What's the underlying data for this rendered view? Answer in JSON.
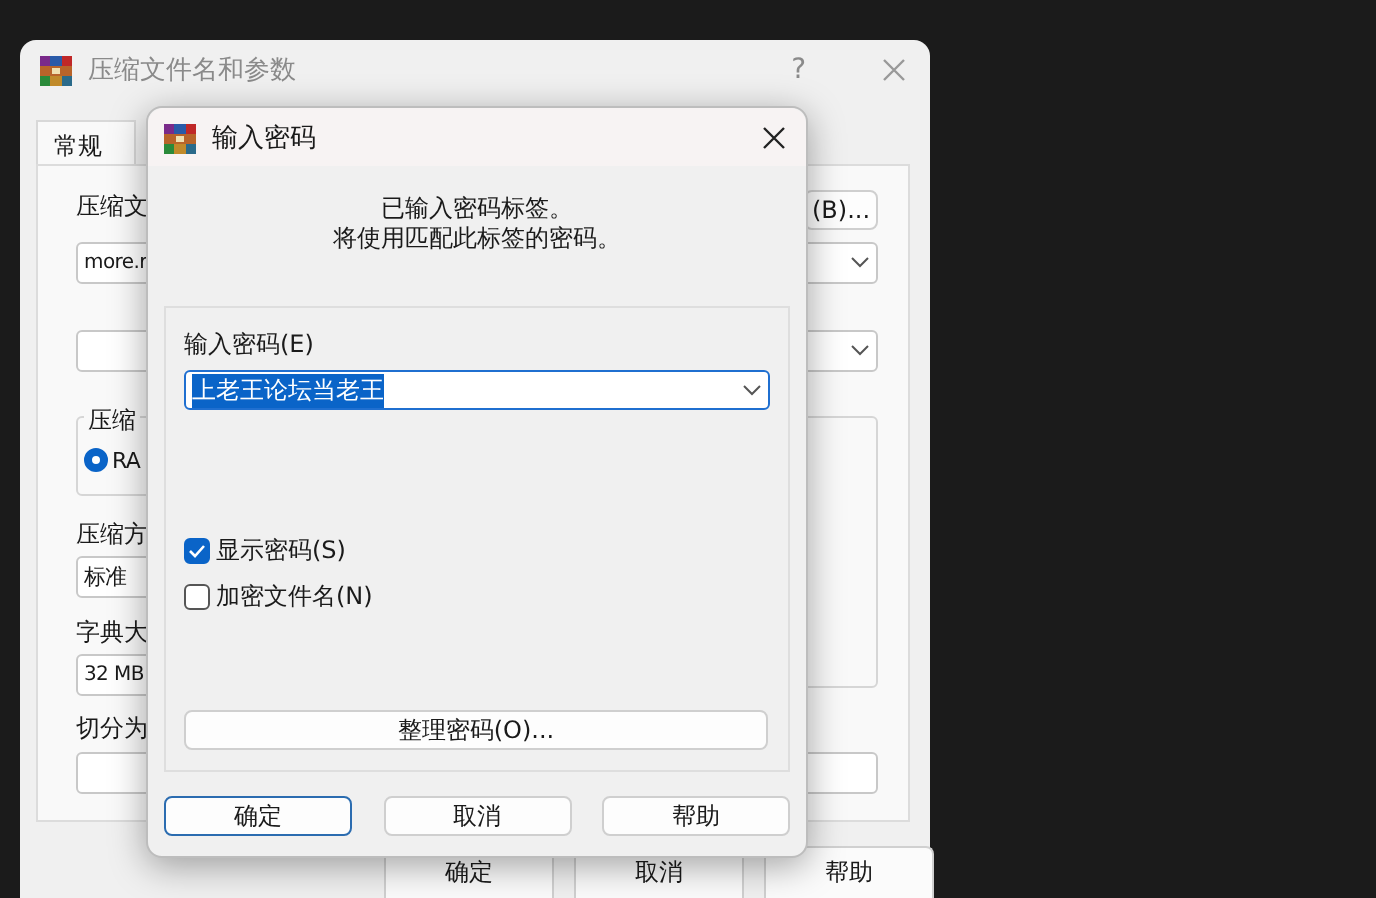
{
  "main_window": {
    "title": "压缩文件名和参数",
    "help": "?",
    "tabs": [
      {
        "label": "常规",
        "selected": true
      }
    ],
    "archive_label": "压缩文",
    "browse_button": "(B)...",
    "archive_name": "more.r",
    "format_group": "压缩",
    "format_option": {
      "label": "RA",
      "selected": true
    },
    "method_label": "压缩方",
    "method_value": "标准",
    "dictionary_label": "字典大",
    "dictionary_value": "32 MB",
    "split_label": "切分为",
    "buttons": [
      "确定",
      "取消",
      "帮助"
    ]
  },
  "dialog": {
    "title": "输入密码",
    "message": [
      "已输入密码标签。",
      "将使用匹配此标签的密码。"
    ],
    "password_label": "输入密码(E)",
    "password_value": "上老王论坛当老王",
    "options": [
      {
        "label": "显示密码(S)",
        "checked": true
      },
      {
        "label": "加密文件名(N)",
        "checked": false
      }
    ],
    "organize_button": "整理密码(O)...",
    "buttons": [
      {
        "label": "确定",
        "default": true
      },
      {
        "label": "取消",
        "default": false
      },
      {
        "label": "帮助",
        "default": false
      }
    ]
  }
}
